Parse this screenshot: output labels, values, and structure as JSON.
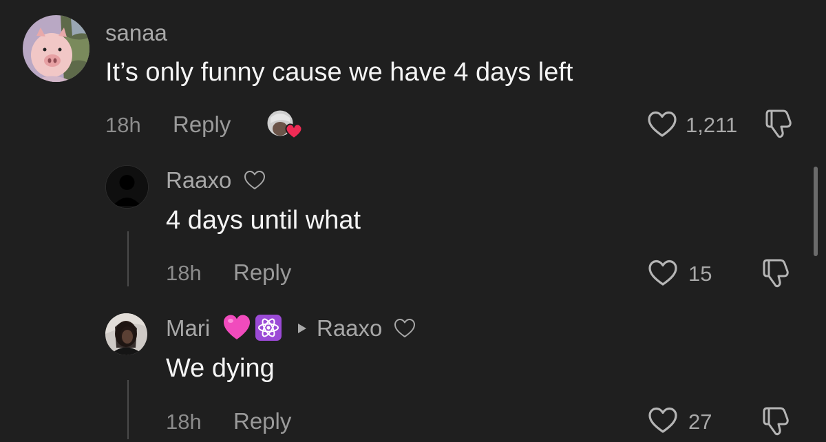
{
  "comments": [
    {
      "username": "sanaa",
      "text": "It’s only funny cause we have 4 days left",
      "time": "18h",
      "reply_label": "Reply",
      "likes": "1,211",
      "avatar_icon": "pig-avatar"
    },
    {
      "username": "Raaxo",
      "text": "4 days until what",
      "time": "18h",
      "reply_label": "Reply",
      "likes": "15",
      "avatar_icon": "default-user-avatar"
    },
    {
      "username": "Mari",
      "reply_to": "Raaxo",
      "text": "We dying",
      "time": "18h",
      "reply_label": "Reply",
      "likes": "27",
      "avatar_icon": "user-photo-avatar"
    }
  ],
  "colors": {
    "background": "#1f1f1f",
    "text_primary": "#f4f4f4",
    "text_secondary": "#a8a8a8",
    "heart_red": "#ef2b55",
    "emoji_pink": "#f14bbd",
    "emoji_purple": "#9b4ad6"
  },
  "icons": {
    "like": "heart-outline-icon",
    "dislike": "thumbs-down-icon",
    "creator_liked": "creator-heart-avatar-icon",
    "name_heart": "small-heart-outline-icon",
    "reply_arrow": "play-triangle-icon",
    "emoji_heart": "pink-heart-emoji",
    "emoji_atom": "atom-symbol-emoji"
  }
}
